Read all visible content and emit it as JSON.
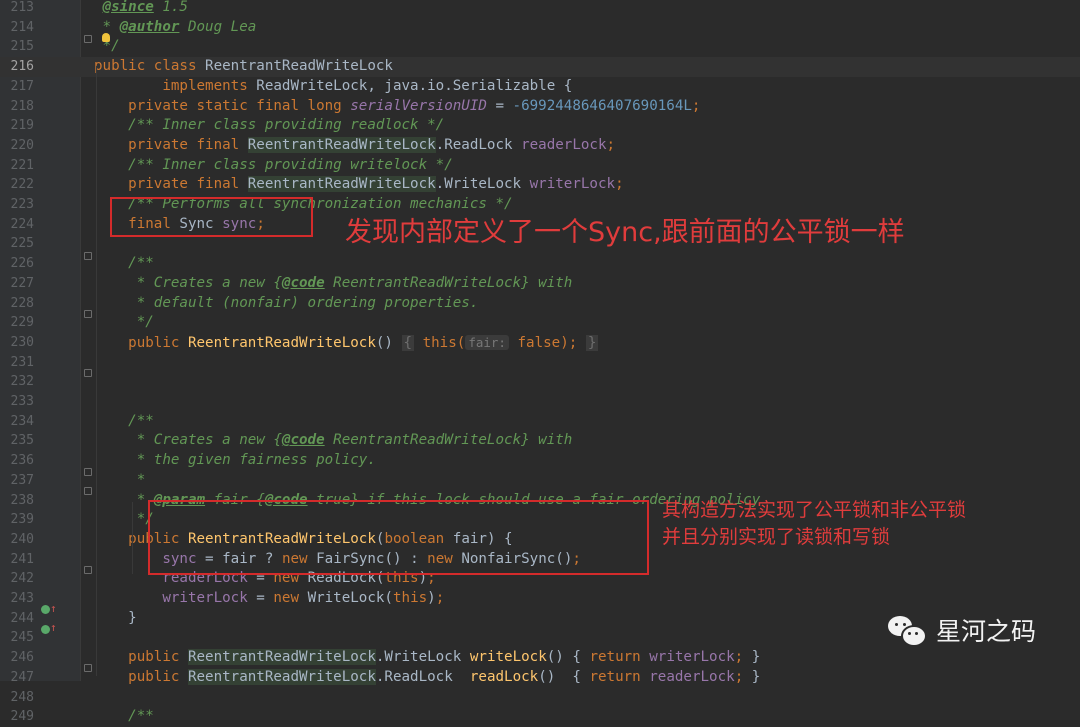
{
  "editor": {
    "current_line": 216,
    "lines": [
      {
        "n": 213,
        "segs": [
          {
            "t": " ",
            "c": ""
          },
          {
            "t": "@since",
            "c": "doctag"
          },
          {
            "t": " 1.5",
            "c": "doc"
          }
        ]
      },
      {
        "n": 214,
        "segs": [
          {
            "t": " * ",
            "c": "doc"
          },
          {
            "t": "@author",
            "c": "doctag"
          },
          {
            "t": " Doug Lea",
            "c": "doc"
          }
        ]
      },
      {
        "n": 215,
        "segs": [
          {
            "t": " */",
            "c": "doc"
          }
        ]
      },
      {
        "n": 216,
        "segs": [
          {
            "t": "public class ",
            "c": "kw"
          },
          {
            "t": "ReentrantReadWriteLock",
            "c": "cls"
          }
        ]
      },
      {
        "n": 217,
        "segs": [
          {
            "t": "        implements ",
            "c": "kw"
          },
          {
            "t": "ReadWriteLock, java.io.Serializable {",
            "c": ""
          }
        ]
      },
      {
        "n": 218,
        "segs": [
          {
            "t": "    private static final long ",
            "c": "kw"
          },
          {
            "t": "serialVersionUID",
            "c": "sfld"
          },
          {
            "t": " = ",
            "c": ""
          },
          {
            "t": "-6992448646407690164L",
            "c": "num"
          },
          {
            "t": ";",
            "c": "kw"
          }
        ]
      },
      {
        "n": 219,
        "segs": [
          {
            "t": "    /** Inner class providing readlock */",
            "c": "doc"
          }
        ]
      },
      {
        "n": 220,
        "segs": [
          {
            "t": "    private final ",
            "c": "kw"
          },
          {
            "t": "ReentrantReadWriteLock",
            "c": "hl"
          },
          {
            "t": ".ReadLock ",
            "c": ""
          },
          {
            "t": "readerLock",
            "c": "fld"
          },
          {
            "t": ";",
            "c": "kw"
          }
        ]
      },
      {
        "n": 221,
        "segs": [
          {
            "t": "    /** Inner class providing writelock */",
            "c": "doc"
          }
        ]
      },
      {
        "n": 222,
        "segs": [
          {
            "t": "    private final ",
            "c": "kw"
          },
          {
            "t": "ReentrantReadWriteLock",
            "c": "hl"
          },
          {
            "t": ".WriteLock ",
            "c": ""
          },
          {
            "t": "writerLock",
            "c": "fld"
          },
          {
            "t": ";",
            "c": "kw"
          }
        ]
      },
      {
        "n": 223,
        "segs": [
          {
            "t": "    /** Performs all synchronization mechanics */",
            "c": "doc"
          }
        ]
      },
      {
        "n": 224,
        "segs": [
          {
            "t": "    final ",
            "c": "kw"
          },
          {
            "t": "Sync ",
            "c": ""
          },
          {
            "t": "sync",
            "c": "fld"
          },
          {
            "t": ";",
            "c": "kw"
          }
        ]
      },
      {
        "n": 225,
        "segs": []
      },
      {
        "n": 226,
        "segs": [
          {
            "t": "    /**",
            "c": "doc"
          }
        ]
      },
      {
        "n": 227,
        "segs": [
          {
            "t": "     * Creates a new ",
            "c": "doc"
          },
          {
            "t": "{",
            "c": "doc"
          },
          {
            "t": "@code",
            "c": "doctag"
          },
          {
            "t": " ReentrantReadWriteLock} with",
            "c": "doc"
          }
        ]
      },
      {
        "n": 228,
        "segs": [
          {
            "t": "     * default (nonfair) ordering properties.",
            "c": "doc"
          }
        ]
      },
      {
        "n": 229,
        "segs": [
          {
            "t": "     */",
            "c": "doc"
          }
        ]
      },
      {
        "n": 230,
        "segs": [
          {
            "t": "    public ",
            "c": "kw"
          },
          {
            "t": "ReentrantReadWriteLock",
            "c": "fn"
          },
          {
            "t": "() ",
            "c": ""
          },
          {
            "t": "{",
            "c": "fold"
          },
          {
            "t": " this(",
            "c": "kw"
          },
          {
            "t": "fair:",
            "c": "hint"
          },
          {
            "t": " false",
            "c": "kw"
          },
          {
            "t": ");",
            "c": "kw"
          },
          {
            "t": " ",
            "c": ""
          },
          {
            "t": "}",
            "c": "fold"
          }
        ]
      },
      {
        "n": 231,
        "segs": []
      },
      {
        "n": 232,
        "segs": []
      },
      {
        "n": 233,
        "segs": []
      },
      {
        "n": 234,
        "segs": [
          {
            "t": "    /**",
            "c": "doc"
          }
        ]
      },
      {
        "n": 235,
        "segs": [
          {
            "t": "     * Creates a new ",
            "c": "doc"
          },
          {
            "t": "{",
            "c": "doc"
          },
          {
            "t": "@code",
            "c": "doctag"
          },
          {
            "t": " ReentrantReadWriteLock} with",
            "c": "doc"
          }
        ]
      },
      {
        "n": 236,
        "segs": [
          {
            "t": "     * the given fairness policy.",
            "c": "doc"
          }
        ]
      },
      {
        "n": 237,
        "segs": [
          {
            "t": "     *",
            "c": "doc"
          }
        ]
      },
      {
        "n": 238,
        "segs": [
          {
            "t": "     * ",
            "c": "doc"
          },
          {
            "t": "@param",
            "c": "doctag"
          },
          {
            "t": " fair ",
            "c": "doc"
          },
          {
            "t": "{",
            "c": "doc"
          },
          {
            "t": "@code",
            "c": "doctag"
          },
          {
            "t": " true} if this lock should use a fair ordering policy",
            "c": "doc"
          }
        ]
      },
      {
        "n": 239,
        "segs": [
          {
            "t": "     */",
            "c": "doc"
          }
        ]
      },
      {
        "n": 240,
        "segs": [
          {
            "t": "    public ",
            "c": "kw"
          },
          {
            "t": "ReentrantReadWriteLock",
            "c": "fn"
          },
          {
            "t": "(",
            "c": ""
          },
          {
            "t": "boolean ",
            "c": "kw"
          },
          {
            "t": "fair) {",
            "c": ""
          }
        ]
      },
      {
        "n": 241,
        "segs": [
          {
            "t": "        ",
            "c": ""
          },
          {
            "t": "sync",
            "c": "fld"
          },
          {
            "t": " = fair ? ",
            "c": ""
          },
          {
            "t": "new ",
            "c": "kw"
          },
          {
            "t": "FairSync() : ",
            "c": ""
          },
          {
            "t": "new ",
            "c": "kw"
          },
          {
            "t": "NonfairSync()",
            "c": ""
          },
          {
            "t": ";",
            "c": "kw"
          }
        ]
      },
      {
        "n": 242,
        "segs": [
          {
            "t": "        ",
            "c": ""
          },
          {
            "t": "readerLock",
            "c": "fld"
          },
          {
            "t": " = ",
            "c": ""
          },
          {
            "t": "new ",
            "c": "kw"
          },
          {
            "t": "ReadLock(",
            "c": ""
          },
          {
            "t": "this",
            "c": "kw"
          },
          {
            "t": ")",
            "c": ""
          },
          {
            "t": ";",
            "c": "kw"
          }
        ]
      },
      {
        "n": 243,
        "segs": [
          {
            "t": "        ",
            "c": ""
          },
          {
            "t": "writerLock",
            "c": "fld"
          },
          {
            "t": " = ",
            "c": ""
          },
          {
            "t": "new ",
            "c": "kw"
          },
          {
            "t": "WriteLock(",
            "c": ""
          },
          {
            "t": "this",
            "c": "kw"
          },
          {
            "t": ")",
            "c": ""
          },
          {
            "t": ";",
            "c": "kw"
          }
        ]
      },
      {
        "n": 244,
        "segs": [
          {
            "t": "    }",
            "c": ""
          }
        ]
      },
      {
        "n": 245,
        "segs": []
      },
      {
        "n": 246,
        "segs": [
          {
            "t": "    public ",
            "c": "kw"
          },
          {
            "t": "ReentrantReadWriteLock",
            "c": "hl"
          },
          {
            "t": ".WriteLock ",
            "c": ""
          },
          {
            "t": "writeLock",
            "c": "fn"
          },
          {
            "t": "() ",
            "c": ""
          },
          {
            "t": "{ ",
            "c": ""
          },
          {
            "t": "return ",
            "c": "kw"
          },
          {
            "t": "writerLock",
            "c": "fld"
          },
          {
            "t": "; ",
            "c": "kw"
          },
          {
            "t": "}",
            "c": ""
          }
        ]
      },
      {
        "n": 247,
        "segs": [
          {
            "t": "    public ",
            "c": "kw"
          },
          {
            "t": "ReentrantReadWriteLock",
            "c": "hl"
          },
          {
            "t": ".ReadLock  ",
            "c": ""
          },
          {
            "t": "readLock",
            "c": "fn"
          },
          {
            "t": "()  ",
            "c": ""
          },
          {
            "t": "{ ",
            "c": ""
          },
          {
            "t": "return ",
            "c": "kw"
          },
          {
            "t": "readerLock",
            "c": "fld"
          },
          {
            "t": "; ",
            "c": "kw"
          },
          {
            "t": "}",
            "c": ""
          }
        ]
      },
      {
        "n": 248,
        "segs": []
      },
      {
        "n": 249,
        "segs": [
          {
            "t": "    /**",
            "c": "doc"
          }
        ]
      }
    ]
  },
  "annotations": {
    "sync_note": "发现内部定义了一个Sync,跟前面的公平锁一样",
    "ctor_note_line1": "其构造方法实现了公平锁和非公平锁",
    "ctor_note_line2": "并且分别实现了读锁和写锁"
  },
  "watermark": {
    "icon": "wechat-icon",
    "text": "星河之码"
  },
  "colors": {
    "background": "#2b2b2b",
    "keyword": "#cc7832",
    "field": "#9876aa",
    "doc_comment": "#629755",
    "number": "#6897bb",
    "method": "#ffc66d",
    "annotation_red": "#d42b2b"
  }
}
